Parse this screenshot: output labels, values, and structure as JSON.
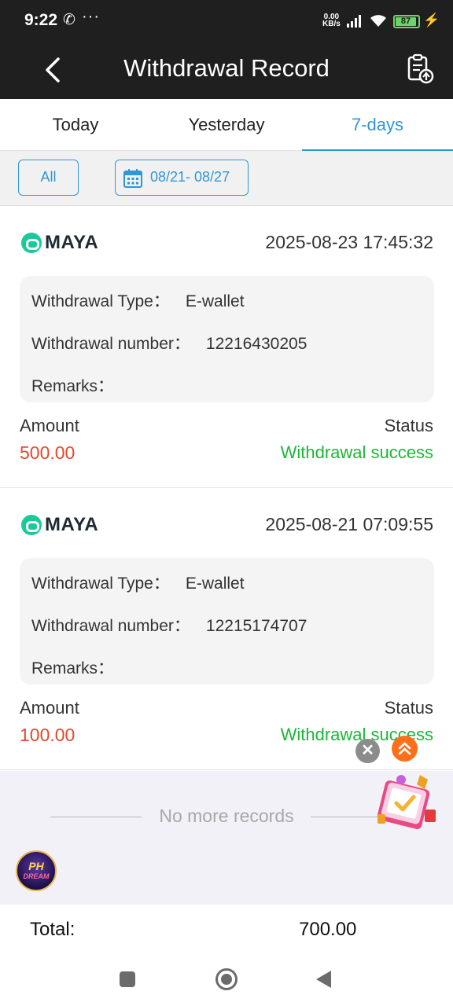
{
  "status_bar": {
    "time": "9:22",
    "call_icon": "call-icon",
    "more": "···",
    "speed_value": "0.00",
    "speed_unit": "KB/s",
    "battery": "87"
  },
  "header": {
    "title": "Withdrawal Record",
    "back_icon": "chevron-left-icon",
    "report_icon": "clipboard-upload-icon"
  },
  "tabs": [
    {
      "label": "Today",
      "active": false
    },
    {
      "label": "Yesterday",
      "active": false
    },
    {
      "label": "7-days",
      "active": true
    }
  ],
  "filters": {
    "all_label": "All",
    "date_range": "08/21- 08/27"
  },
  "records": [
    {
      "brand": "MAYA",
      "time": "2025-08-23 17:45:32",
      "type_label": "Withdrawal Type：",
      "type_value": "E-wallet",
      "number_label": "Withdrawal number：",
      "number_value": "12216430205",
      "remarks_label": "Remarks：",
      "remarks_value": "",
      "amount_label": "Amount",
      "amount": "500.00",
      "status_label": "Status",
      "status": "Withdrawal success"
    },
    {
      "brand": "MAYA",
      "time": "2025-08-21 07:09:55",
      "type_label": "Withdrawal Type：",
      "type_value": "E-wallet",
      "number_label": "Withdrawal number：",
      "number_value": "12215174707",
      "remarks_label": "Remarks：",
      "remarks_value": "",
      "amount_label": "Amount",
      "amount": "100.00",
      "status_label": "Status",
      "status": "Withdrawal success"
    }
  ],
  "footer": {
    "no_more": "No more records",
    "ph_logo_top": "PH",
    "ph_logo_bottom": "DREAM"
  },
  "total": {
    "label": "Total:",
    "value": "700.00"
  },
  "colors": {
    "accent": "#2e97d6",
    "amount": "#e04a2e",
    "success": "#1db53a",
    "header_bg": "#1f1f1f"
  }
}
